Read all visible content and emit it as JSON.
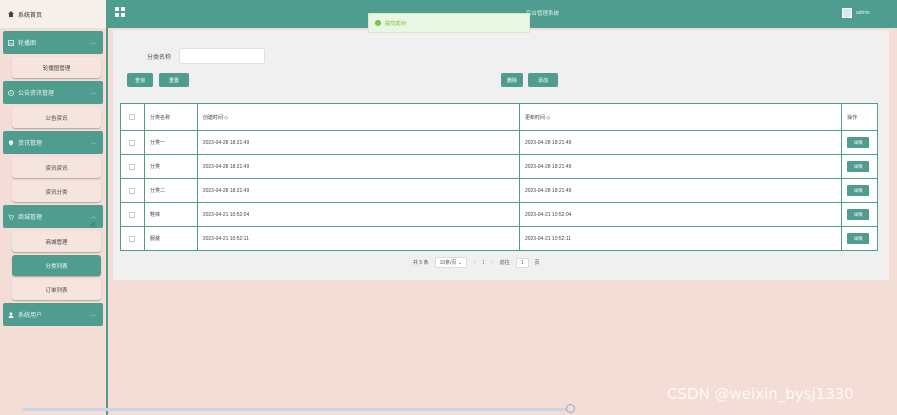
{
  "sidebar": {
    "home": "系统首页",
    "groups": [
      {
        "label": "轮播图",
        "items": [
          "轮播图管理"
        ]
      },
      {
        "label": "公告资讯管理",
        "items": [
          "公告资讯"
        ]
      },
      {
        "label": "资讯管理",
        "items": [
          "资讯资讯",
          "资讯分类"
        ]
      },
      {
        "label": "商城管理",
        "items": [
          "商城管理",
          "分类列表",
          "订单列表"
        ]
      },
      {
        "label": "系统用户",
        "items": []
      }
    ]
  },
  "topbar": {
    "title": "后台管理系统",
    "user": "admin"
  },
  "toast": {
    "message": "提交成功!"
  },
  "search": {
    "label": "分类名称",
    "placeholder": ""
  },
  "buttons": {
    "query": "查询",
    "reset": "重置",
    "delete": "删除",
    "add": "添加",
    "detail": "详情"
  },
  "table": {
    "headers": [
      "分类名称",
      "创建时间 ◇",
      "更新时间 ◇",
      "操作"
    ],
    "rows": [
      {
        "name": "分类一",
        "created": "2023-04-28 18:21:49",
        "updated": "2023-04-28 18:21:49"
      },
      {
        "name": "分类",
        "created": "2023-04-28 18:21:49",
        "updated": "2023-04-28 18:21:49"
      },
      {
        "name": "分类二",
        "created": "2023-04-28 18:21:49",
        "updated": "2023-04-28 18:21:49"
      },
      {
        "name": "鞋袜",
        "created": "2023-04-21 10:52:04",
        "updated": "2023-04-21 10:52:04"
      },
      {
        "name": "服装",
        "created": "2023-04-21 10:52:11",
        "updated": "2023-04-21 10:52:11"
      }
    ]
  },
  "pagination": {
    "total": "共 5 条",
    "page_size": "10条/页",
    "prev": "<",
    "current": "1",
    "next": ">",
    "goto_label": "前往",
    "goto_value": "1",
    "page_suffix": "页"
  },
  "watermark": "CSDN @weixin_bysj1330",
  "colors": {
    "accent": "#4f9d8f",
    "background": "#f4ddd6",
    "success": "#67c23a"
  }
}
